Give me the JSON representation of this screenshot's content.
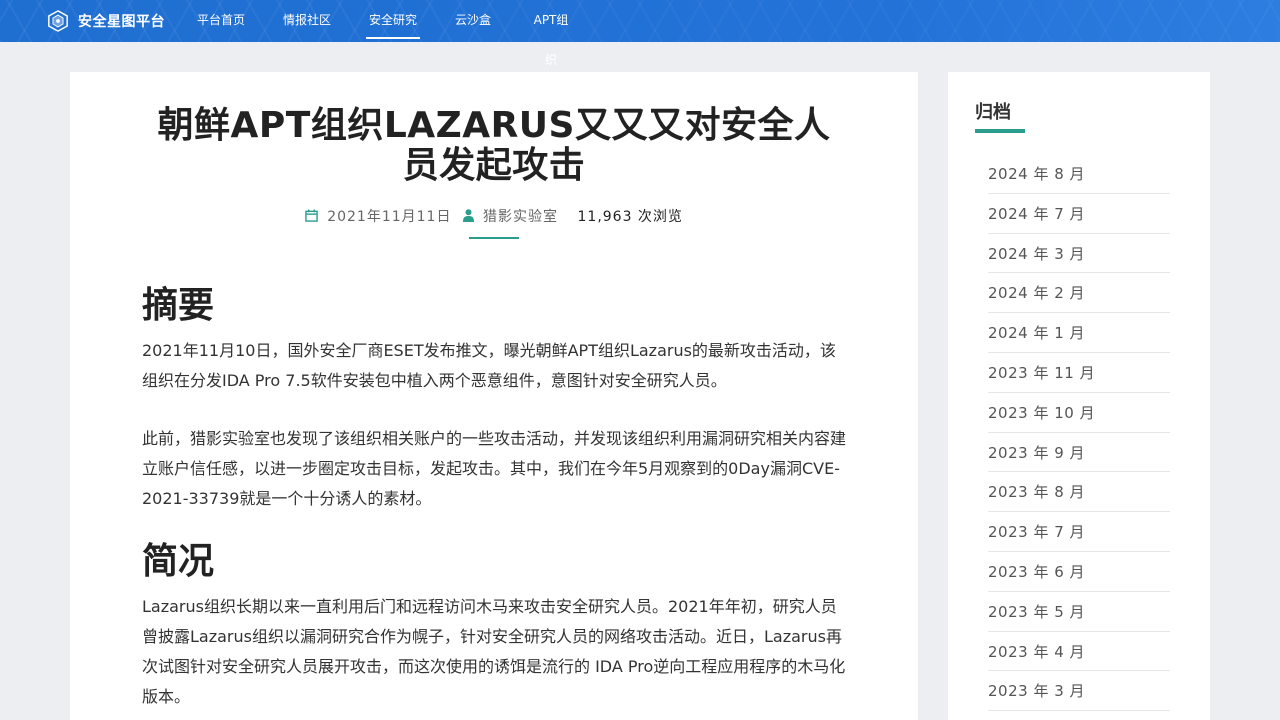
{
  "brand": {
    "name": "安全星图平台",
    "logo": "shield-logo-icon"
  },
  "nav": [
    {
      "label": "平台首页",
      "active": false
    },
    {
      "label": "情报社区",
      "active": false
    },
    {
      "label": "安全研究",
      "active": true
    },
    {
      "label": "云沙盒",
      "active": false
    },
    {
      "label": "APT组织",
      "active": false
    }
  ],
  "article": {
    "title": "朝鲜APT组织LAZARUS又又又对安全人员发起攻击",
    "date": "2021年11月11日",
    "author": "猎影实验室",
    "views": "11,963 次浏览",
    "sections": [
      {
        "heading": "摘要"
      },
      {
        "heading": "简况"
      }
    ],
    "paragraphs": [
      "2021年11月10日，国外安全厂商ESET发布推文，曝光朝鲜APT组织Lazarus的最新攻击活动，该组织在分发IDA Pro 7.5软件安装包中植入两个恶意组件，意图针对安全研究人员。",
      "此前，猎影实验室也发现了该组织相关账户的一些攻击活动，并发现该组织利用漏洞研究相关内容建立账户信任感，以进一步圈定攻击目标，发起攻击。其中，我们在今年5月观察到的0Day漏洞CVE-2021-33739就是一个十分诱人的素材。",
      "Lazarus组织长期以来一直利用后门和远程访问木马来攻击安全研究人员。2021年年初，研究人员曾披露Lazarus组织以漏洞研究合作为幌子，针对安全研究人员的网络攻击活动。近日，Lazarus再次试图针对安全研究人员展开攻击，而这次使用的诱饵是流行的 IDA Pro逆向工程应用程序的木马化版本。"
    ],
    "accent_color": "#2a9d8f"
  },
  "sidebar": {
    "title": "归档",
    "archives": [
      "2024 年 8 月",
      "2024 年 7 月",
      "2024 年 3 月",
      "2024 年 2 月",
      "2024 年 1 月",
      "2023 年 11 月",
      "2023 年 10 月",
      "2023 年 9 月",
      "2023 年 8 月",
      "2023 年 7 月",
      "2023 年 6 月",
      "2023 年 5 月",
      "2023 年 4 月",
      "2023 年 3 月"
    ]
  },
  "colors": {
    "nav_bg": "#1f6fd1",
    "page_bg": "#eceef1",
    "accent": "#2a9d8f"
  }
}
